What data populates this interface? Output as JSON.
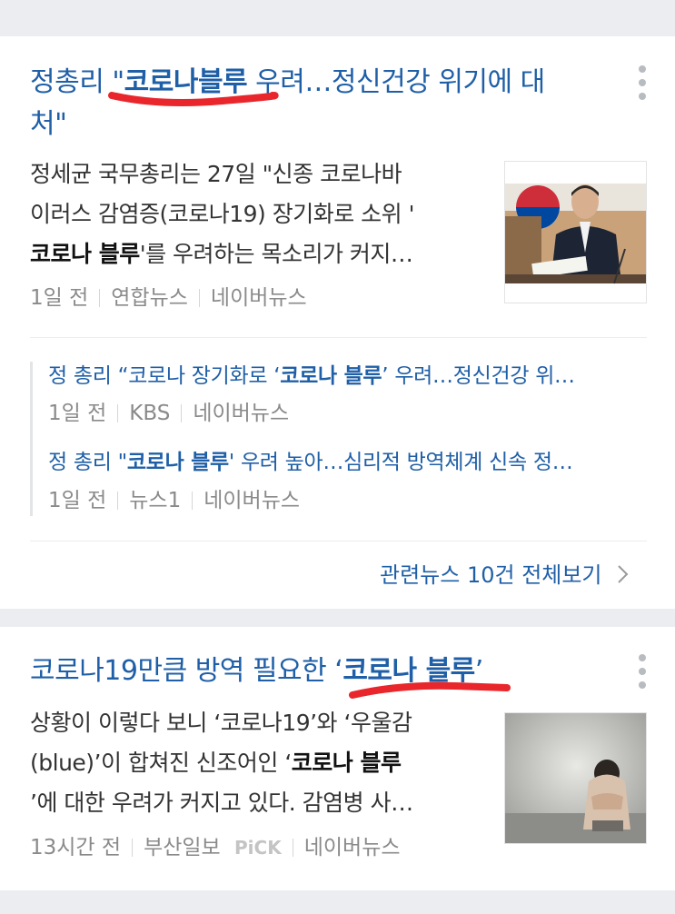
{
  "articles": [
    {
      "title_line1_a": "정총리 \"",
      "title_line1_hl": "코로나블루",
      "title_line1_b": " 우려…정신건강 위기에 대",
      "title_line2": "처\"",
      "summary_line1": "정세균 국무총리는 27일 \"신종 코로나바",
      "summary_line2": "이러스 감염증(코로나19) 장기화로 소위 '",
      "summary_line3_hl": "코로나 블루",
      "summary_line3_b": "'를 우려하는 목소리가 커지…",
      "time": "1일 전",
      "press": "연합뉴스",
      "source": "네이버뉴스",
      "thumb_icon": "press-photo-prime-minister",
      "related": [
        {
          "pre": "정 총리 “코로나 장기화로 ‘",
          "hl": "코로나 블루",
          "post": "’ 우려…정신건강 위…",
          "time": "1일 전",
          "press": "KBS",
          "source": "네이버뉴스"
        },
        {
          "pre": "정 총리 \"",
          "hl": "코로나 블루",
          "post": "' 우려 높아…심리적 방역체계 신속 정…",
          "time": "1일 전",
          "press": "뉴스1",
          "source": "네이버뉴스"
        }
      ],
      "related_all": "관련뉴스 10건 전체보기"
    },
    {
      "title_a": "코로나19만큼 방역 필요한 ‘",
      "title_hl": "코로나 블루",
      "title_b": "’",
      "summary_line1": "상황이 이렇다 보니 ‘코로나19’와 ‘우울감",
      "summary_line2_a": "(blue)’이 합쳐진 신조어인 ‘",
      "summary_line2_hl": "코로나 블루",
      "summary_line3": "’에 대한 우려가 커지고 있다. 감염병 사…",
      "time": "13시간 전",
      "press": "부산일보",
      "badge": "PiCK",
      "source": "네이버뉴스",
      "thumb_icon": "photo-person-hugging-knees"
    }
  ],
  "colors": {
    "link": "#1f5fa7",
    "annotation": "#e8262b",
    "background": "#ebedf0"
  }
}
